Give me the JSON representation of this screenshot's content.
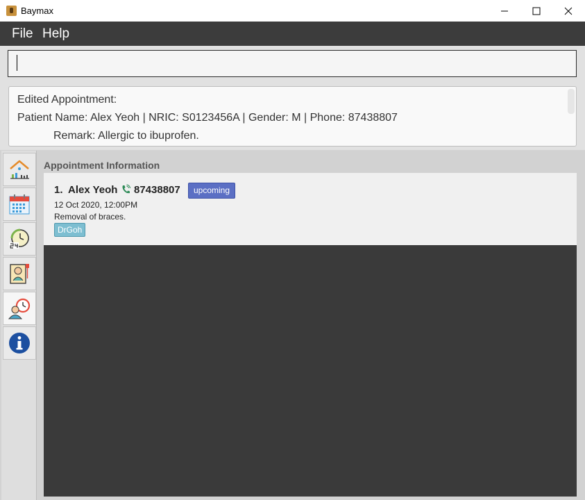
{
  "window": {
    "title": "Baymax"
  },
  "menu": {
    "file": "File",
    "help": "Help"
  },
  "command": {
    "value": ""
  },
  "result": {
    "line1": "Edited Appointment:",
    "line2": "Patient Name: Alex Yeoh | NRIC: S0123456A | Gender: M | Phone: 87438807",
    "line3": "Remark: Allergic to ibuprofen."
  },
  "sidebar": {
    "tabs": [
      {
        "icon": "home-dashboard-icon"
      },
      {
        "icon": "calendar-icon"
      },
      {
        "icon": "clock-24h-icon"
      },
      {
        "icon": "patient-record-icon"
      },
      {
        "icon": "doctor-appointment-icon",
        "active": true
      },
      {
        "icon": "info-icon"
      }
    ]
  },
  "panel": {
    "title": "Appointment Information"
  },
  "appointments": [
    {
      "index": "1.",
      "name": "Alex Yeoh",
      "phone": "87438807",
      "status": "upcoming",
      "datetime": "12 Oct 2020, 12:00PM",
      "description": "Removal of braces.",
      "tag": "DrGoh"
    }
  ],
  "colors": {
    "menubar": "#3c3c3c",
    "status_badge": "#5b6fc4",
    "doctor_tag": "#7dbed1",
    "list_bg": "#3a3a3a"
  }
}
